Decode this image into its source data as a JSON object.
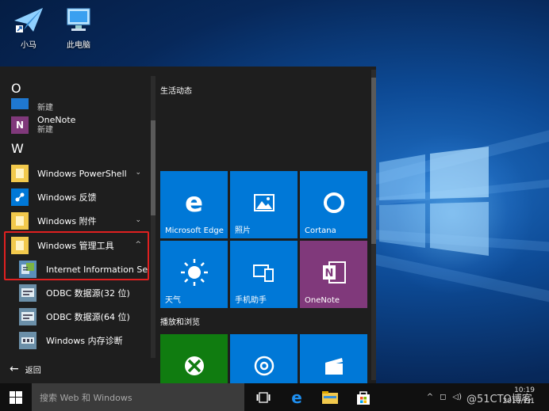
{
  "desktop": {
    "icons": [
      {
        "label": "小马",
        "icon": "paper-plane-shortcut-icon"
      },
      {
        "label": "此电脑",
        "icon": "computer-icon"
      }
    ]
  },
  "start_menu": {
    "app_list": {
      "letter_o": "O",
      "letter_w": "W",
      "new_badge_1": "新建",
      "onenote_label": "OneNote",
      "new_badge_2": "新建",
      "items": [
        {
          "label": "Windows PowerShell",
          "chevron": "⌄"
        },
        {
          "label": "Windows 反馈"
        },
        {
          "label": "Windows 附件",
          "chevron": "⌄"
        },
        {
          "label": "Windows 管理工具",
          "chevron": "^"
        }
      ],
      "sub_items": [
        {
          "label": "Internet Information Ser..."
        },
        {
          "label": "ODBC 数据源(32 位)"
        },
        {
          "label": "ODBC 数据源(64 位)"
        },
        {
          "label": "Windows 内存诊断"
        }
      ],
      "back_label": "返回"
    },
    "tiles": {
      "group1_title": "生活动态",
      "group2_title": "播放和浏览",
      "tiles": [
        {
          "label": "Microsoft Edge",
          "color": "#0078d7",
          "icon": "edge-icon"
        },
        {
          "label": "照片",
          "color": "#0078d7",
          "icon": "photos-icon"
        },
        {
          "label": "Cortana",
          "color": "#0078d7",
          "icon": "cortana-icon"
        },
        {
          "label": "天气",
          "color": "#0078d7",
          "icon": "weather-sun-icon"
        },
        {
          "label": "手机助手",
          "color": "#0078d7",
          "icon": "phone-companion-icon"
        },
        {
          "label": "OneNote",
          "color": "#80397b",
          "icon": "onenote-icon"
        },
        {
          "label": "",
          "color": "#107c10",
          "icon": "xbox-icon"
        },
        {
          "label": "",
          "color": "#0078d7",
          "icon": "groove-music-icon"
        },
        {
          "label": "",
          "color": "#0078d7",
          "icon": "movies-tv-icon"
        }
      ]
    }
  },
  "taskbar": {
    "search_placeholder": "搜索 Web 和 Windows",
    "clock_time": "10:19",
    "clock_date": "2019/7/1"
  },
  "watermark": "@51CTO博客",
  "colors": {
    "highlight": "#e02020",
    "accent": "#0078d7"
  }
}
